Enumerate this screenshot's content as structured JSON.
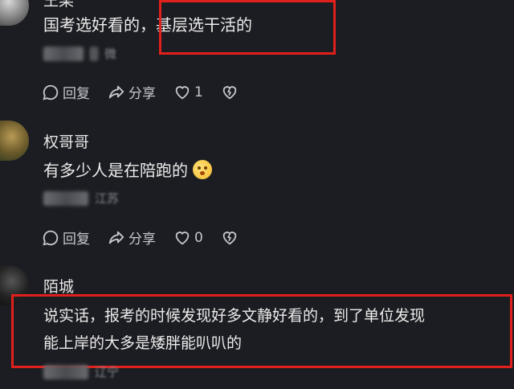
{
  "comments": [
    {
      "name": "王某",
      "content": "国考选好看的，基层选干活的",
      "meta": "微",
      "actions": {
        "reply": "回复",
        "share": "分享",
        "likes": "1"
      }
    },
    {
      "name": "权哥哥",
      "content": "有多少人是在陪跑的",
      "meta": "江苏",
      "actions": {
        "reply": "回复",
        "share": "分享",
        "likes": "0"
      }
    },
    {
      "name": "陌城",
      "content_line1": "说实话，报考的时候发现好多文静好看的，到了单位发现",
      "content_line2": "能上岸的大多是矮胖能叭叭的",
      "meta": "辽宁"
    }
  ],
  "colors": {
    "highlight_box": "#e0201c",
    "background": "#1c1d22"
  },
  "icons": [
    "comment-icon",
    "share-icon",
    "heart-icon",
    "broken-heart-icon"
  ]
}
